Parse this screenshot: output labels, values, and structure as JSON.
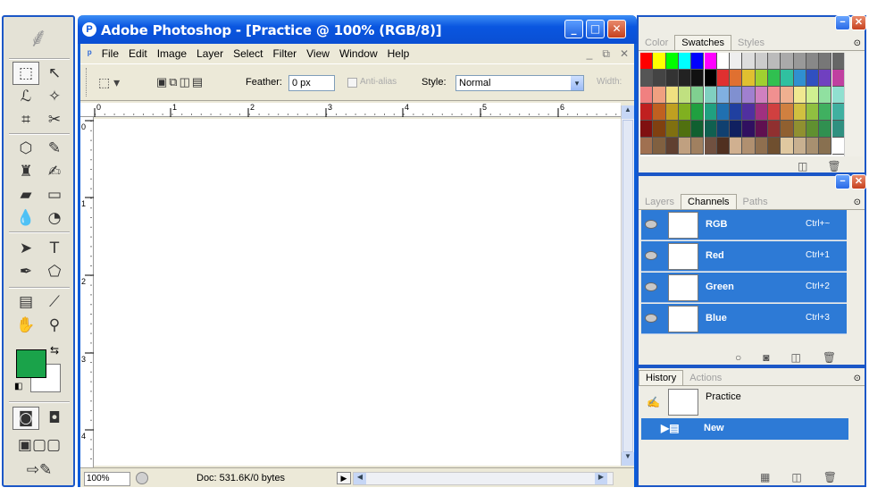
{
  "app": {
    "window_title": "Adobe Photoshop - [Practice @ 100% (RGB/8)]",
    "title_icon": "photoshop-icon"
  },
  "menu": [
    "File",
    "Edit",
    "Image",
    "Layer",
    "Select",
    "Filter",
    "View",
    "Window",
    "Help"
  ],
  "options": {
    "feather_label": "Feather:",
    "feather_value": "0 px",
    "antialias_label": "Anti-alias",
    "style_label": "Style:",
    "style_value": "Normal",
    "width_label": "Width:"
  },
  "ruler": {
    "h_ticks": [
      "0",
      "1",
      "2",
      "3",
      "4",
      "5",
      "6"
    ],
    "v_ticks": [
      "0",
      "1",
      "2",
      "3",
      "4"
    ]
  },
  "status": {
    "zoom": "100%",
    "doc": "Doc: 531.6K/0 bytes"
  },
  "swatches_panel": {
    "tabs": [
      "Color",
      "Swatches",
      "Styles"
    ],
    "active_tab": "Swatches"
  },
  "channels_panel": {
    "tabs": [
      "Layers",
      "Channels",
      "Paths"
    ],
    "active_tab": "Channels",
    "rows": [
      {
        "name": "RGB",
        "shortcut": "Ctrl+~"
      },
      {
        "name": "Red",
        "shortcut": "Ctrl+1"
      },
      {
        "name": "Green",
        "shortcut": "Ctrl+2"
      },
      {
        "name": "Blue",
        "shortcut": "Ctrl+3"
      }
    ]
  },
  "history_panel": {
    "tabs": [
      "History",
      "Actions"
    ],
    "active_tab": "History",
    "snapshot": "Practice",
    "state": "New"
  },
  "colors": {
    "titlebar": "#0a56e0",
    "foreground": "#1aa34a",
    "background": "#ffffff",
    "selected_row": "#2d7ad6"
  }
}
